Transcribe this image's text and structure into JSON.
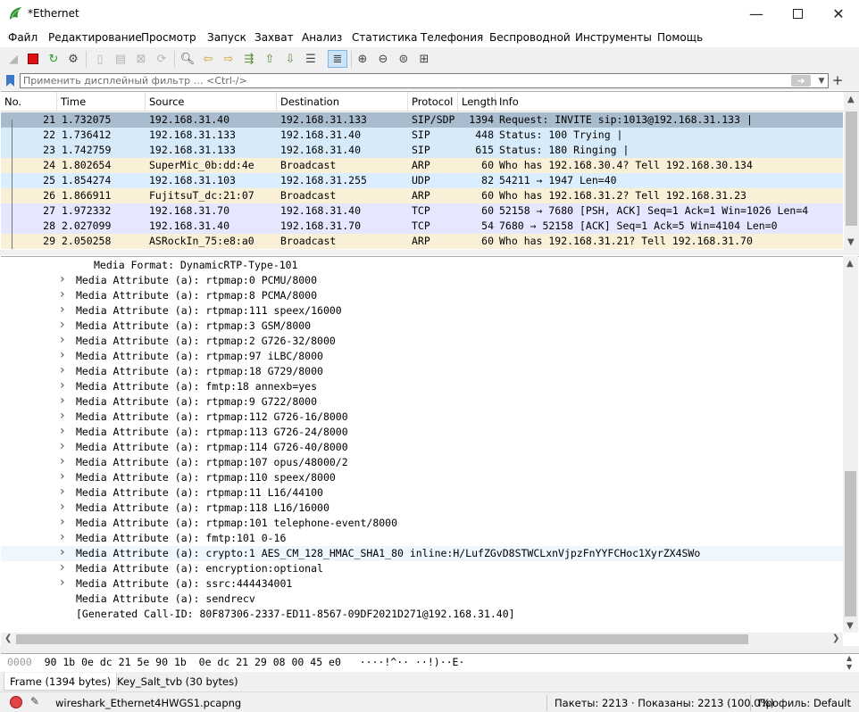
{
  "window": {
    "title": "*Ethernet"
  },
  "menu": [
    "Файл",
    "Редактирование",
    "Просмотр",
    "Запуск",
    "Захват",
    "Анализ",
    "Статистика",
    "Телефония",
    "Беспроводной",
    "Инструменты",
    "Помощь"
  ],
  "filter": {
    "placeholder": "Применить дисплейный фильтр … <Ctrl-/>"
  },
  "packet_list": {
    "columns": [
      "No.",
      "Time",
      "Source",
      "Destination",
      "Protocol",
      "Length",
      "Info"
    ],
    "rows": [
      {
        "no": "21",
        "time": "1.732075",
        "source": "192.168.31.40",
        "destination": "192.168.31.133",
        "protocol": "SIP/SDP",
        "length": "1394",
        "info": "Request: INVITE sip:1013@192.168.31.133 |",
        "color": "#a9bccd"
      },
      {
        "no": "22",
        "time": "1.736412",
        "source": "192.168.31.133",
        "destination": "192.168.31.40",
        "protocol": "SIP",
        "length": "448",
        "info": "Status: 100 Trying |",
        "color": "#d6eaf9"
      },
      {
        "no": "23",
        "time": "1.742759",
        "source": "192.168.31.133",
        "destination": "192.168.31.40",
        "protocol": "SIP",
        "length": "615",
        "info": "Status: 180 Ringing |",
        "color": "#d6eaf9"
      },
      {
        "no": "24",
        "time": "1.802654",
        "source": "SuperMic_0b:dd:4e",
        "destination": "Broadcast",
        "protocol": "ARP",
        "length": "60",
        "info": "Who has 192.168.30.4? Tell 192.168.30.134",
        "color": "#faf0d7"
      },
      {
        "no": "25",
        "time": "1.854274",
        "source": "192.168.31.103",
        "destination": "192.168.31.255",
        "protocol": "UDP",
        "length": "82",
        "info": "54211 → 1947 Len=40",
        "color": "#daeeff"
      },
      {
        "no": "26",
        "time": "1.866911",
        "source": "FujitsuT_dc:21:07",
        "destination": "Broadcast",
        "protocol": "ARP",
        "length": "60",
        "info": "Who has 192.168.31.2? Tell 192.168.31.23",
        "color": "#faf0d7"
      },
      {
        "no": "27",
        "time": "1.972332",
        "source": "192.168.31.70",
        "destination": "192.168.31.40",
        "protocol": "TCP",
        "length": "60",
        "info": "52158 → 7680 [PSH, ACK] Seq=1 Ack=1 Win=1026 Len=4",
        "color": "#e7e6ff"
      },
      {
        "no": "28",
        "time": "2.027099",
        "source": "192.168.31.40",
        "destination": "192.168.31.70",
        "protocol": "TCP",
        "length": "54",
        "info": "7680 → 52158 [ACK] Seq=1 Ack=5 Win=4104 Len=0",
        "color": "#e7e6ff"
      },
      {
        "no": "29",
        "time": "2.050258",
        "source": "ASRockIn_75:e8:a0",
        "destination": "Broadcast",
        "protocol": "ARP",
        "length": "60",
        "info": "Who has 192.168.31.21? Tell 192.168.31.70",
        "color": "#faf0d7"
      }
    ]
  },
  "detail": {
    "media_format": "Media Format: DynamicRTP-Type-101",
    "lines": [
      "Media Attribute (a): rtpmap:0 PCMU/8000",
      "Media Attribute (a): rtpmap:8 PCMA/8000",
      "Media Attribute (a): rtpmap:111 speex/16000",
      "Media Attribute (a): rtpmap:3 GSM/8000",
      "Media Attribute (a): rtpmap:2 G726-32/8000",
      "Media Attribute (a): rtpmap:97 iLBC/8000",
      "Media Attribute (a): rtpmap:18 G729/8000",
      "Media Attribute (a): fmtp:18 annexb=yes",
      "Media Attribute (a): rtpmap:9 G722/8000",
      "Media Attribute (a): rtpmap:112 G726-16/8000",
      "Media Attribute (a): rtpmap:113 G726-24/8000",
      "Media Attribute (a): rtpmap:114 G726-40/8000",
      "Media Attribute (a): rtpmap:107 opus/48000/2",
      "Media Attribute (a): rtpmap:110 speex/8000",
      "Media Attribute (a): rtpmap:11 L16/44100",
      "Media Attribute (a): rtpmap:118 L16/16000",
      "Media Attribute (a): rtpmap:101 telephone-event/8000",
      "Media Attribute (a): fmtp:101 0-16",
      "Media Attribute (a): crypto:1 AES_CM_128_HMAC_SHA1_80 inline:H/LufZGvD8STWCLxnVjpzFnYYFCHoc1XyrZX4SWo",
      "Media Attribute (a): encryption:optional",
      "Media Attribute (a): ssrc:444434001",
      "Media Attribute (a): sendrecv",
      "[Generated Call-ID: 80F87306-2337-ED11-8567-09DF2021D271@192.168.31.40]"
    ]
  },
  "bytes": {
    "offset": "0000",
    "hex": "90 1b 0e dc 21 5e 90 1b  0e dc 21 29 08 00 45 e0",
    "ascii": "····!^·· ··!)··E·"
  },
  "bytes_tabs": [
    "Frame (1394 bytes)",
    "Key_Salt_tvb (30 bytes)"
  ],
  "status": {
    "file": "wireshark_Ethernet4HWGS1.pcapng",
    "packets": "Пакеты: 2213 · Показаны: 2213 (100.0%)",
    "profile": "Профиль: Default"
  }
}
